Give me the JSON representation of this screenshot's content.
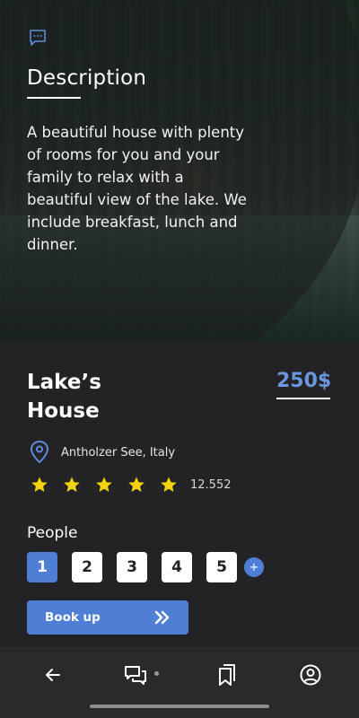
{
  "description": {
    "title": "Description",
    "text": "A beautiful house with plenty of rooms for you and your family to relax with a beautiful view of the lake. We include breakfast, lunch and dinner."
  },
  "listing": {
    "title": "Lake’s House",
    "price": "250$",
    "location": "Antholzer See, Italy",
    "rating_stars": 5,
    "reviews_count": "12.552"
  },
  "people": {
    "label": "People",
    "options": [
      "1",
      "2",
      "3",
      "4",
      "5"
    ],
    "selected": "1",
    "add_label": "+"
  },
  "book_button": {
    "label": "Book up"
  },
  "nav": {
    "items": [
      "back-icon",
      "chat-icon",
      "bookmarks-icon",
      "profile-icon"
    ]
  },
  "colors": {
    "accent": "#4f7fd4",
    "price": "#6a96e0",
    "star": "#f5d20c",
    "background": "#232325",
    "navbar": "#2a2a2c"
  }
}
